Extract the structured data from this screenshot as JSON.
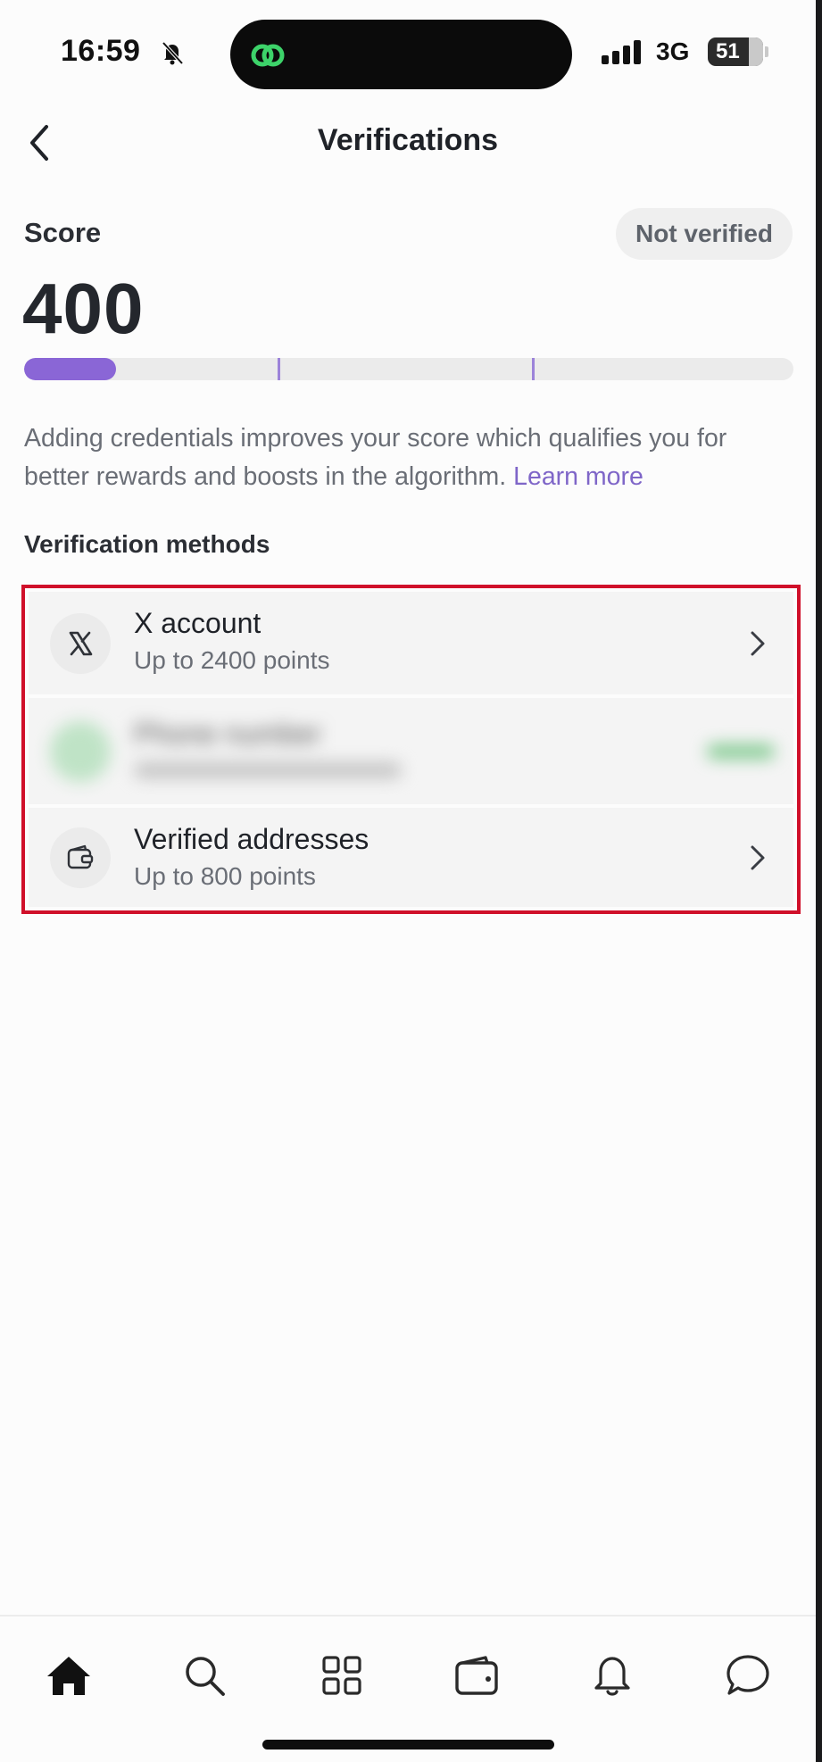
{
  "status_bar": {
    "time": "16:59",
    "network": "3G",
    "battery": "51"
  },
  "header": {
    "title": "Verifications"
  },
  "score": {
    "label": "Score",
    "value": "400",
    "badge": "Not verified",
    "progress_fraction": 0.12,
    "milestone_fractions": [
      0.33,
      0.66
    ]
  },
  "description": {
    "text": "Adding credentials improves your score which qualifies you for better rewards and boosts in the algorithm. ",
    "link": "Learn more"
  },
  "methods": {
    "section_title": "Verification methods",
    "items": [
      {
        "title": "X account",
        "subtitle": "Up to 2400 points",
        "icon": "x-logo-icon"
      },
      {
        "title": "Phone number",
        "subtitle": "",
        "icon": "phone-icon"
      },
      {
        "title": "Verified addresses",
        "subtitle": "Up to 800 points",
        "icon": "wallet-icon"
      }
    ]
  },
  "colors": {
    "accent": "#8a66d6",
    "highlight_border": "#d0102a",
    "link": "#7f66c8"
  },
  "bottom_nav": [
    "home-icon",
    "search-icon",
    "grid-icon",
    "wallet-icon",
    "bell-icon",
    "chat-icon"
  ]
}
